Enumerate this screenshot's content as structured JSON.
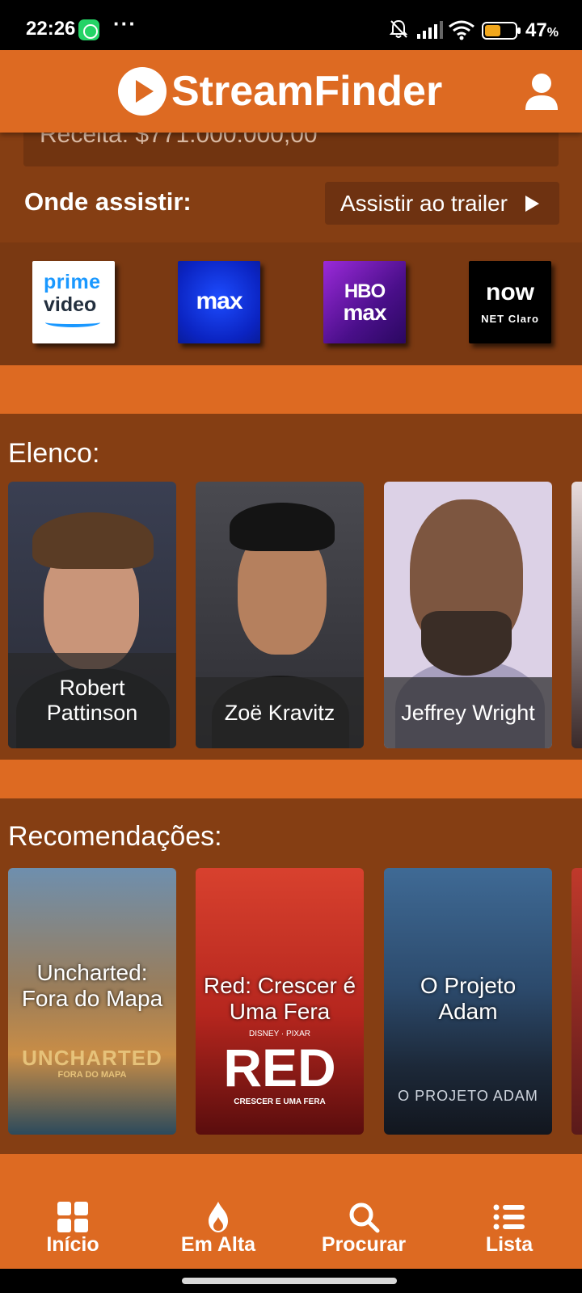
{
  "status_bar": {
    "time": "22:26",
    "dots": "···",
    "battery_percent": "47",
    "battery_unit": "%",
    "battery_level": 0.47
  },
  "header": {
    "app_title": "StreamFinder"
  },
  "movie": {
    "receita": "Receita: $771.000.000,00",
    "onde_assistir": "Onde assistir:",
    "trailer_button": "Assistir ao trailer"
  },
  "providers": [
    {
      "name": "Prime Video",
      "line1": "prime",
      "line2": "video"
    },
    {
      "name": "Max",
      "line1": "max"
    },
    {
      "name": "HBO Max",
      "line1": "HBO",
      "line2": "max"
    },
    {
      "name": "NOW NET Claro",
      "line1": "now",
      "line2": "NET Claro"
    }
  ],
  "cast": {
    "title": "Elenco:",
    "items": [
      {
        "name": "Robert Pattinson"
      },
      {
        "name": "Zoë Kravitz"
      },
      {
        "name": "Jeffrey Wright"
      }
    ]
  },
  "recommendations": {
    "title": "Recomendações:",
    "items": [
      {
        "title": "Uncharted: Fora do Mapa",
        "poster_text": "UNCHARTED",
        "poster_subtext": "FORA DO MAPA"
      },
      {
        "title": "Red: Crescer é Uma Fera",
        "poster_text": "RED",
        "poster_subtext": "CRESCER E UMA FERA",
        "poster_brand": "DISNEY · PIXAR"
      },
      {
        "title": "O Projeto Adam",
        "poster_text": "O PROJETO ADAM"
      }
    ]
  },
  "bottom_nav": [
    {
      "label": "Início",
      "icon": "grid-icon"
    },
    {
      "label": "Em Alta",
      "icon": "flame-icon"
    },
    {
      "label": "Procurar",
      "icon": "search-icon"
    },
    {
      "label": "Lista",
      "icon": "list-icon"
    }
  ],
  "colors": {
    "primary": "#dd6a22",
    "panel": "#853e13",
    "panel_dark": "#7a3912"
  }
}
